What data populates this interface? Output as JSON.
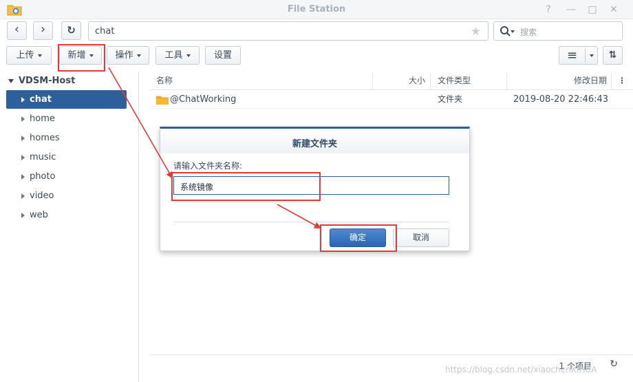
{
  "window": {
    "title": "File Station",
    "help": "?",
    "minimize": "—",
    "maximize": "□",
    "close": "✕"
  },
  "toolbar": {
    "back": "‹",
    "forward": "›",
    "refresh": "↻",
    "path": "chat",
    "favorite": "★",
    "search_placeholder": "搜索",
    "upload": "上传",
    "create": "新增",
    "action": "操作",
    "tools": "工具",
    "settings": "设置",
    "view_list": "≡",
    "sort": "⇅"
  },
  "sidebar": {
    "root": "VDSM-Host",
    "items": [
      {
        "label": "chat",
        "selected": true
      },
      {
        "label": "home"
      },
      {
        "label": "homes"
      },
      {
        "label": "music"
      },
      {
        "label": "photo"
      },
      {
        "label": "video"
      },
      {
        "label": "web"
      }
    ]
  },
  "list": {
    "columns": [
      "名称",
      "大小",
      "文件类型",
      "修改日期"
    ],
    "more": "⋮",
    "rows": [
      {
        "name": "@ChatWorking",
        "size": "",
        "type": "文件夹",
        "modified": "2019-08-20 22:46:43"
      }
    ]
  },
  "footer": {
    "count": "1 个项目",
    "refresh": "↻"
  },
  "dialog": {
    "title": "新建文件夹",
    "label": "请输入文件夹名称:",
    "value": "系统镜像",
    "ok": "确定",
    "cancel": "取消"
  },
  "watermark": "https://blog.csdn.net/xiaochenXIHUA",
  "colors": {
    "accent": "#2d5f9a",
    "annotation": "#e53935",
    "folder": "#f5a623"
  }
}
